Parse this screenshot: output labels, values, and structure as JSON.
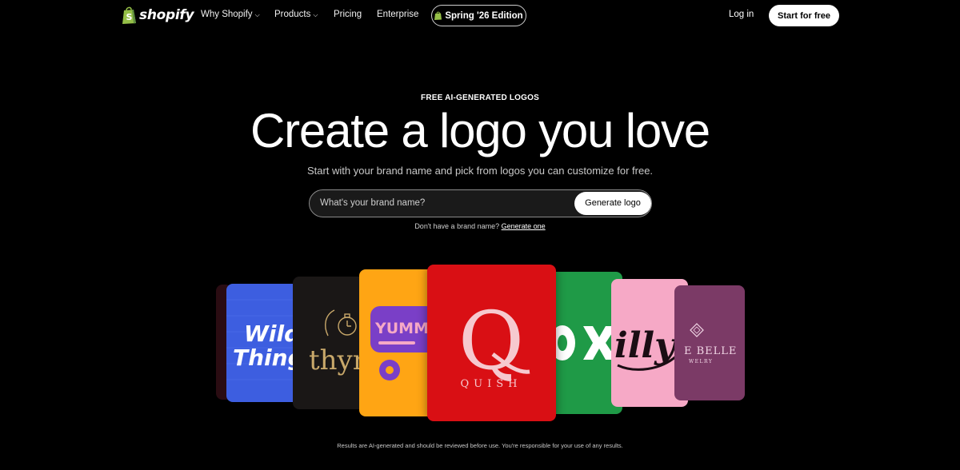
{
  "nav": {
    "brand": "shopify",
    "links": [
      {
        "label": "Why Shopify",
        "dropdown": true
      },
      {
        "label": "Products",
        "dropdown": true
      },
      {
        "label": "Pricing",
        "dropdown": false
      },
      {
        "label": "Enterprise",
        "dropdown": false
      }
    ],
    "edition_label": "Spring '26 Edition",
    "login_label": "Log in",
    "start_label": "Start for free"
  },
  "hero": {
    "eyebrow": "FREE AI-GENERATED LOGOS",
    "headline": "Create a logo you love",
    "subline": "Start with your brand name and pick from logos you can customize for free.",
    "search_placeholder": "What's your brand name?",
    "generate_button": "Generate logo",
    "helper_prefix": "Don't have a brand name?",
    "helper_link": "Generate one"
  },
  "logo_cards": [
    {
      "id": "wild",
      "text_lines": [
        "Wild",
        "Things"
      ],
      "bg": "#3d5ee0"
    },
    {
      "id": "thyme",
      "text": "thyme",
      "bg": "#1a1716"
    },
    {
      "id": "yummy",
      "text": "YUMMY",
      "bg": "#ffa514"
    },
    {
      "id": "quish",
      "letter": "Q",
      "text": "QUISH",
      "bg": "#d90f14"
    },
    {
      "id": "ox",
      "text": "OX",
      "bg": "#1f9a47"
    },
    {
      "id": "milly",
      "text": "illy",
      "bg": "#f6a9c6"
    },
    {
      "id": "belle",
      "text": "E BELLE",
      "subtext": "WELRY",
      "bg": "#7b3a66"
    }
  ],
  "disclaimer": "Results are AI-generated and should be reviewed before use. You're responsible for your use of any results.",
  "colors": {
    "background": "#000000",
    "text": "#ffffff",
    "button_bg": "#ffffff",
    "shopify_green": "#95bf47"
  }
}
